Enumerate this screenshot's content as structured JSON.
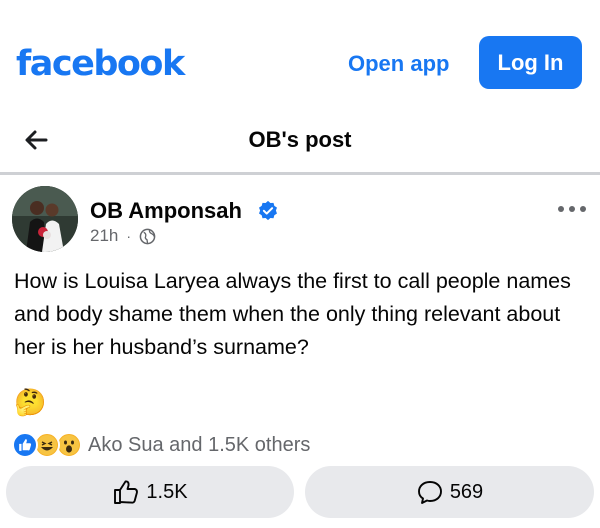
{
  "header": {
    "logo": "facebook",
    "open_app_label": "Open app",
    "login_label": "Log In"
  },
  "post_bar": {
    "title": "OB's post"
  },
  "post": {
    "author": "OB Amponsah",
    "time": "21h",
    "separator": "·",
    "text": "How is Louisa Laryea always the first to call people names and body shame them when the only thing relevant about her is her husband’s surname?",
    "emoji": "🤔"
  },
  "reactions": {
    "summary": "Ako Sua and 1.5K others"
  },
  "actions": {
    "like_count": "1.5K",
    "comment_count": "569"
  },
  "colors": {
    "brand": "#1877f2",
    "secondary_text": "#65676b",
    "button_bg": "#e8e9ec"
  },
  "icons": [
    "back-arrow-icon",
    "verified-badge-icon",
    "globe-icon",
    "more-options-icon",
    "thumbs-up-icon",
    "comment-icon"
  ]
}
